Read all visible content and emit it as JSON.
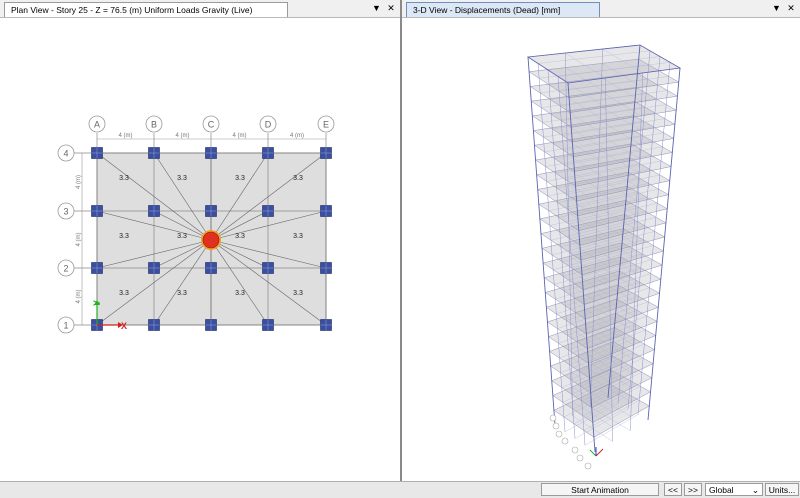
{
  "left_pane": {
    "tab_title": "Plan View - Story 25 - Z = 76.5 (m)  Uniform Loads Gravity  (Live)",
    "grid_x": [
      "A",
      "B",
      "C",
      "D",
      "E"
    ],
    "grid_y": [
      "4",
      "3",
      "2",
      "1"
    ],
    "spacing_x": "4 (m)",
    "spacing_y": "4 (m)",
    "load_value": "3.3",
    "axis_x": "X",
    "axis_y": "Y"
  },
  "right_pane": {
    "tab_title": "3-D View   - Displacements (Dead)  [mm]"
  },
  "window_buttons": {
    "menu": "▼",
    "close": "✕"
  },
  "status_bar": {
    "start_animation": "Start Animation",
    "prev": "<<",
    "next": ">>",
    "coord_system": "Global",
    "units": "Units..."
  },
  "colors": {
    "column": "#3a4fa0",
    "slab": "#dedede",
    "highlight": "#e03020"
  }
}
